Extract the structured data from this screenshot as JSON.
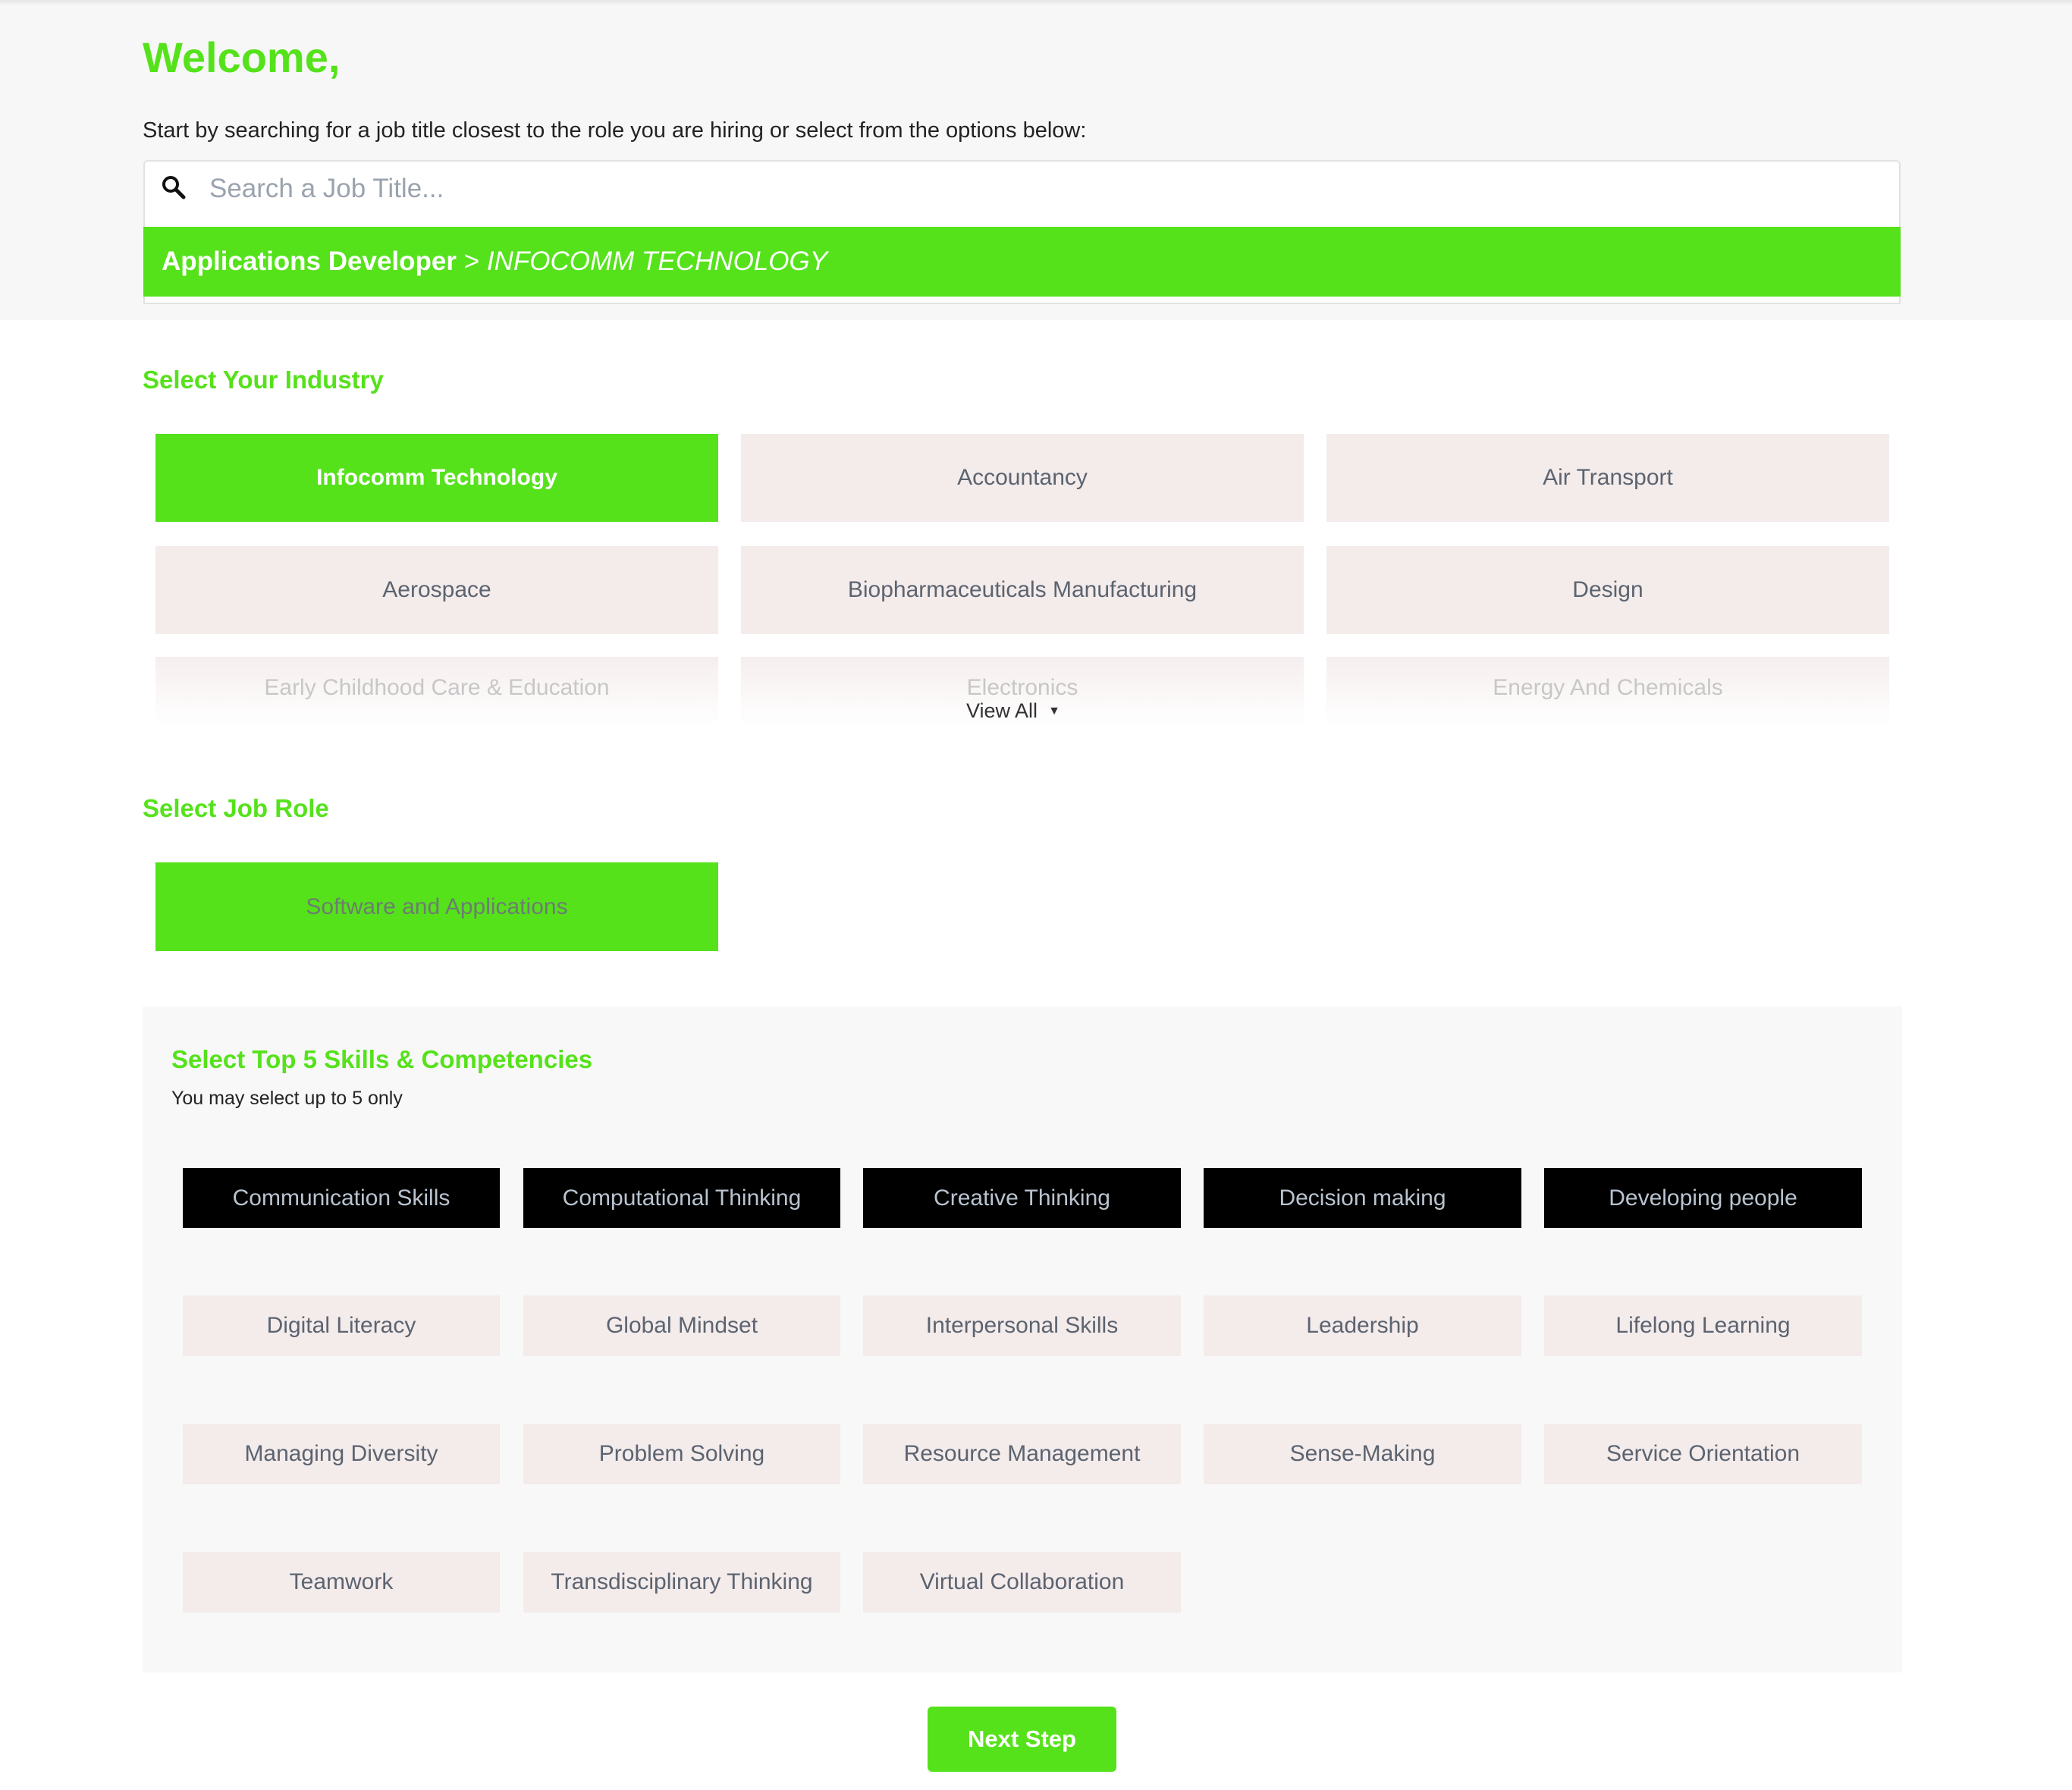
{
  "header": {
    "welcome": "Welcome,",
    "instruction": "Start by searching for a job title closest to the role you are hiring or select from the options below:"
  },
  "search": {
    "placeholder": "Search a Job Title...",
    "suggestion_title": "Applications Developer",
    "suggestion_separator": " > ",
    "suggestion_category": "INFOCOMM TECHNOLOGY"
  },
  "industry": {
    "title": "Select Your Industry",
    "items": [
      {
        "label": "Infocomm Technology",
        "selected": true
      },
      {
        "label": "Accountancy"
      },
      {
        "label": "Air Transport"
      },
      {
        "label": "Aerospace"
      },
      {
        "label": "Biopharmaceuticals Manufacturing"
      },
      {
        "label": "Design"
      },
      {
        "label": "Early Childhood Care & Education"
      },
      {
        "label": "Electronics"
      },
      {
        "label": "Energy And Chemicals"
      }
    ],
    "view_all": "View All"
  },
  "job_role": {
    "title": "Select Job Role",
    "items": [
      {
        "label": "Software and Applications",
        "selected": true
      }
    ]
  },
  "skills": {
    "title": "Select Top 5 Skills & Competencies",
    "subtitle": "You may select up to 5 only",
    "items": [
      {
        "label": "Communication Skills",
        "selected": true
      },
      {
        "label": "Computational Thinking",
        "selected": true
      },
      {
        "label": "Creative Thinking",
        "selected": true
      },
      {
        "label": "Decision making",
        "selected": true
      },
      {
        "label": "Developing people",
        "selected": true
      },
      {
        "label": "Digital Literacy"
      },
      {
        "label": "Global Mindset"
      },
      {
        "label": "Interpersonal Skills"
      },
      {
        "label": "Leadership"
      },
      {
        "label": "Lifelong Learning"
      },
      {
        "label": "Managing Diversity"
      },
      {
        "label": "Problem Solving"
      },
      {
        "label": "Resource Management"
      },
      {
        "label": "Sense-Making"
      },
      {
        "label": "Service Orientation"
      },
      {
        "label": "Teamwork"
      },
      {
        "label": "Transdisciplinary Thinking"
      },
      {
        "label": "Virtual Collaboration"
      }
    ]
  },
  "actions": {
    "next_label": "Next Step"
  },
  "colors": {
    "accent": "#55e21b",
    "tile_bg": "#f4ebeb",
    "selected_skill_bg": "#000000"
  }
}
